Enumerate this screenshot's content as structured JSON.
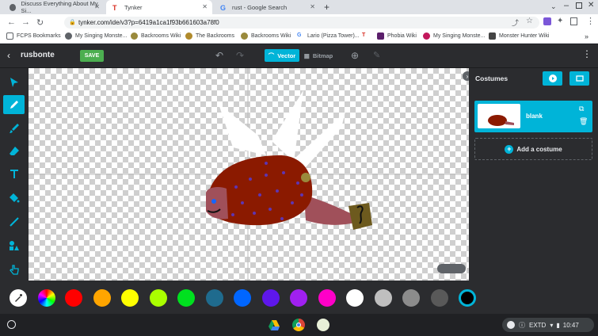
{
  "tabs": [
    {
      "title": "Discuss Everything About My Si..."
    },
    {
      "title": "Tynker"
    },
    {
      "title": "rust - Google Search"
    }
  ],
  "url": "tynker.com/ide/v3?p=6419a1ca1f93b661603a78f0",
  "bookmarks": [
    "FCPS Bookmarks",
    "My Singing Monste...",
    "Backrooms Wiki",
    "The Backrooms",
    "Backrooms Wiki",
    "Lario (Pizza Tower)...",
    "Phobia Wiki",
    "My Singing Monste...",
    "Monster Hunter Wiki"
  ],
  "app": {
    "project_name": "rusbonte",
    "save_label": "SAVE",
    "vector_label": "Vector",
    "bitmap_label": "Bitmap"
  },
  "costumes": {
    "header": "Costumes",
    "items": [
      {
        "name": "blank"
      }
    ],
    "add_label": "Add a costume"
  },
  "palette": [
    "#ff0000",
    "#ffa500",
    "#ffff00",
    "#aaff00",
    "#00e01f",
    "#1f6b8e",
    "#0066ff",
    "#5e17eb",
    "#a020f0",
    "#ff00c8",
    "#ffffff",
    "#bfbfbf",
    "#8c8c8c",
    "#595959",
    "#000000"
  ],
  "colors": {
    "accent": "#00b4d8",
    "save": "#4caf50"
  },
  "system": {
    "status": "EXTD",
    "time": "10:47"
  }
}
